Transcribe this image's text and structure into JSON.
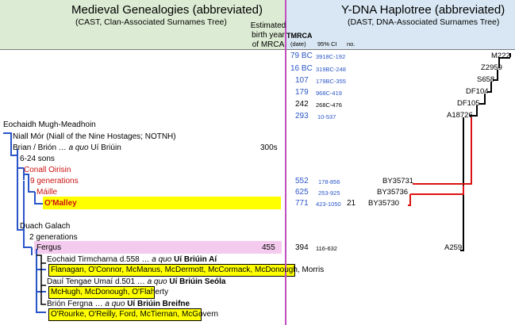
{
  "header": {
    "left_title": "Medieval Genealogies (abbreviated)",
    "left_subtitle": "(CAST, Clan-Associated Surnames Tree)",
    "right_title": "Y-DNA Haplotree (abbreviated)",
    "right_subtitle": "(DAST, DNA-Associated Surnames Tree)",
    "col_birth_year": [
      "Estimated",
      "birth year",
      "of MRCA"
    ],
    "col_tmrca": "TMRCA",
    "col_tmrca_sub": "(date)",
    "col_ci": "95% CI",
    "col_no": "no."
  },
  "dates": [
    {
      "tmrca": "79 BC",
      "ci": "3918C-192",
      "color": "blue"
    },
    {
      "tmrca": "16 BC",
      "ci": "319BC-248",
      "color": "blue"
    },
    {
      "tmrca": "107",
      "ci": "179BC-355",
      "color": "blue"
    },
    {
      "tmrca": "179",
      "ci": "968C-419",
      "color": "blue"
    },
    {
      "tmrca": "242",
      "ci": "268C-476",
      "color": "black"
    },
    {
      "tmrca": "293",
      "ci": "10-537",
      "color": "blue"
    }
  ],
  "haplogroups": {
    "M222": "M222",
    "Z2959": "Z2959",
    "S658": "S658",
    "DF104": "DF104",
    "DF105": "DF105",
    "A18726": "A18726",
    "BY35731": "BY35731",
    "BY35736": "BY35736",
    "BY35730": "BY35730",
    "A259": "A259"
  },
  "genealogy": {
    "eochaidh": "Eochaidh Mugh-Meadhoin",
    "niall": "Niall Mór (Niall of the Nine Hostages; NOTNH)",
    "brian_prefix": "Brian / Brión …",
    "brian_aquo": "a quo",
    "brian_suffix": "Uí Briúin",
    "brian_year": "300s",
    "sons": "6-24 sons",
    "conall": "Conall Oirisin",
    "nine_gen": "9 generations",
    "maille": "Máille",
    "omalley": "O'Malley",
    "duach": "Duach Galach",
    "two_gen": "2 generations",
    "fergus": "Fergus",
    "fergus_year": "455",
    "eochaid_prefix": "Eochaid Tirmcharna d.558 …",
    "eochaid_aquo": "a quo",
    "eochaid_suffix": "Uí Briúin Aí",
    "eochaid_surnames": "Flanagan, O'Connor, McManus, McDermott, McCormack, McDonough, Morris",
    "daui_prefix": "Dauí Tengae Umaí d.501 …",
    "daui_aquo": "a quo",
    "daui_suffix": "Uí Briúin Seóla",
    "daui_surnames": "McHugh, McDonough, O'Flaherty",
    "brion_prefix": "Brión Fergna …",
    "brion_aquo": "a quo",
    "brion_suffix": "Uí Briúin Breifne",
    "brion_surnames": "O'Rourke, O'Reilly, Ford, McTiernan, McGovern"
  },
  "rows": {
    "conall_row": {
      "tmrca": "552",
      "ci": "178-856"
    },
    "maille_row": {
      "tmrca": "625",
      "ci": "253-925"
    },
    "omalley_row": {
      "tmrca": "771",
      "ci": "423-1050",
      "no": "21"
    },
    "fergus_row": {
      "tmrca": "394",
      "ci": "116-632"
    }
  },
  "colors": {
    "left_header_bg": "#dcebd3",
    "right_header_bg": "#d8e7f3",
    "divider": "#c04fc0",
    "highlight": "#ffff00",
    "fergus_highlight": "#f4cbee",
    "blue_text": "#2a55c8",
    "red_text": "#cc1111"
  }
}
